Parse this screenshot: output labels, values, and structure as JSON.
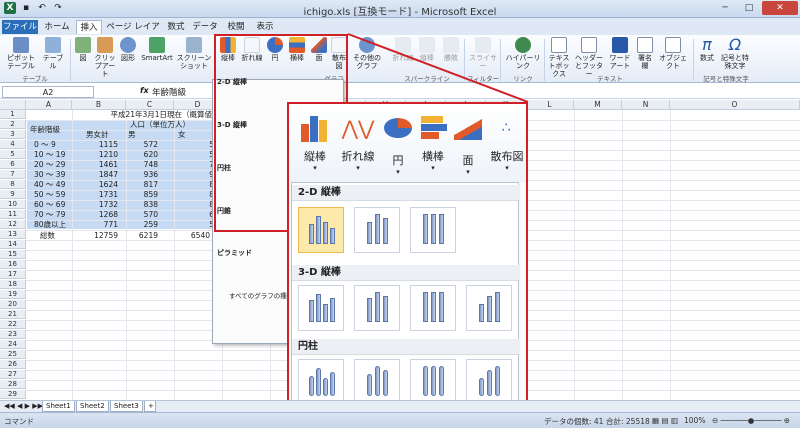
{
  "window": {
    "title": "ichigo.xls [互換モード] - Microsoft Excel",
    "qat_icons": [
      "excel-logo-icon",
      "save-icon",
      "undo-icon",
      "redo-icon"
    ],
    "buttons": {
      "minimize": "─",
      "maximize": "□",
      "close": "✕"
    }
  },
  "tabs": [
    {
      "label": "ファイル",
      "type": "file"
    },
    {
      "label": "ホーム"
    },
    {
      "label": "挿入",
      "active": true
    },
    {
      "label": "ページ レイアウト"
    },
    {
      "label": "数式"
    },
    {
      "label": "データ"
    },
    {
      "label": "校閲"
    },
    {
      "label": "表示"
    }
  ],
  "ribbon": {
    "buttons": [
      {
        "label": "ピボットテーブル",
        "icon": "pivottable-icon"
      },
      {
        "label": "テーブル",
        "icon": "table-icon"
      },
      {
        "label": "図",
        "icon": "picture-icon"
      },
      {
        "label": "クリップアート",
        "icon": "clipart-icon"
      },
      {
        "label": "図形",
        "icon": "shapes-icon"
      },
      {
        "label": "SmartArt",
        "icon": "smartart-icon"
      },
      {
        "label": "スクリーンショット",
        "icon": "screenshot-icon"
      },
      {
        "label": "縦棒",
        "icon": "column-chart-icon"
      },
      {
        "label": "折れ線",
        "icon": "line-chart-icon"
      },
      {
        "label": "円",
        "icon": "pie-chart-icon"
      },
      {
        "label": "横棒",
        "icon": "bar-chart-icon"
      },
      {
        "label": "面",
        "icon": "area-chart-icon"
      },
      {
        "label": "散布図",
        "icon": "scatter-chart-icon"
      },
      {
        "label": "その他のグラフ",
        "icon": "other-charts-icon"
      },
      {
        "label": "折れ線",
        "icon": "sparkline-line-icon"
      },
      {
        "label": "縦棒",
        "icon": "sparkline-column-icon"
      },
      {
        "label": "勝敗",
        "icon": "sparkline-winloss-icon"
      },
      {
        "label": "スライサー",
        "icon": "slicer-icon"
      },
      {
        "label": "ハイパーリンク",
        "icon": "hyperlink-icon"
      },
      {
        "label": "テキストボックス",
        "icon": "textbox-icon"
      },
      {
        "label": "ヘッダーとフッター",
        "icon": "header-footer-icon"
      },
      {
        "label": "ワードアート",
        "icon": "wordart-icon"
      },
      {
        "label": "署名欄",
        "icon": "signature-icon"
      },
      {
        "label": "オブジェクト",
        "icon": "object-icon"
      },
      {
        "label": "数式",
        "icon": "equation-icon"
      },
      {
        "label": "記号と特殊文字",
        "icon": "symbol-icon"
      }
    ],
    "groups": [
      "テーブル",
      "グラフ",
      "スパークライン",
      "フィルター",
      "リンク",
      "テキスト",
      "記号と特殊文字"
    ]
  },
  "formula_bar": {
    "cell": "A2",
    "fx": "fx",
    "value": "年齢階級"
  },
  "columns": [
    "A",
    "B",
    "C",
    "D",
    "E",
    "F",
    "G",
    "H",
    "I",
    "J",
    "K",
    "L",
    "M",
    "N",
    "O"
  ],
  "rows": [
    "1",
    "2",
    "3",
    "4",
    "5",
    "6",
    "7",
    "8",
    "9",
    "10",
    "11",
    "12",
    "13",
    "14",
    "15",
    "16",
    "17",
    "18",
    "19",
    "20",
    "21",
    "22",
    "23",
    "24",
    "25",
    "26",
    "27",
    "28",
    "29"
  ],
  "sheet": {
    "title": "平成21年3月1日現在（概算値）",
    "header_age": "年齢階級",
    "header_pop": "人口（単位万人）",
    "header_total": "男女計",
    "header_male": "男",
    "header_female": "女",
    "data": [
      [
        "0 ～ 9",
        "1115",
        "572",
        "5"
      ],
      [
        "10 ～ 19",
        "1210",
        "620",
        "5"
      ],
      [
        "20 ～ 29",
        "1461",
        "748",
        "7"
      ],
      [
        "30 ～ 39",
        "1847",
        "936",
        "9"
      ],
      [
        "40 ～ 49",
        "1624",
        "817",
        "8"
      ],
      [
        "50 ～ 59",
        "1731",
        "859",
        "8"
      ],
      [
        "60 ～ 69",
        "1732",
        "838",
        "8"
      ],
      [
        "70 ～ 79",
        "1268",
        "570",
        "6"
      ],
      [
        "80歳以上",
        "771",
        "259",
        "5"
      ]
    ],
    "total": [
      "総数",
      "12759",
      "6219",
      "6540"
    ]
  },
  "small_dropdown": {
    "sections": [
      "2-D 縦棒",
      "3-D 縦棒",
      "円柱",
      "円錐",
      "ピラミッド"
    ],
    "footer": "すべてのグラフの種類"
  },
  "zoom": {
    "chart_types": [
      {
        "label": "縦棒",
        "icon": "column-chart-icon"
      },
      {
        "label": "折れ線",
        "icon": "line-chart-icon"
      },
      {
        "label": "円",
        "icon": "pie-chart-icon"
      },
      {
        "label": "横棒",
        "icon": "bar-chart-icon"
      },
      {
        "label": "面",
        "icon": "area-chart-icon"
      },
      {
        "label": "散布図",
        "icon": "scatter-chart-icon"
      }
    ],
    "sections": [
      "2-D 縦棒",
      "3-D 縦棒",
      "円柱",
      "円錐"
    ]
  },
  "sheets": [
    "Sheet1",
    "Sheet2",
    "Sheet3"
  ],
  "status": {
    "mode": "コマンド",
    "count": "データの個数: 41",
    "sum": "合計: 25518",
    "zoom": "100%"
  }
}
